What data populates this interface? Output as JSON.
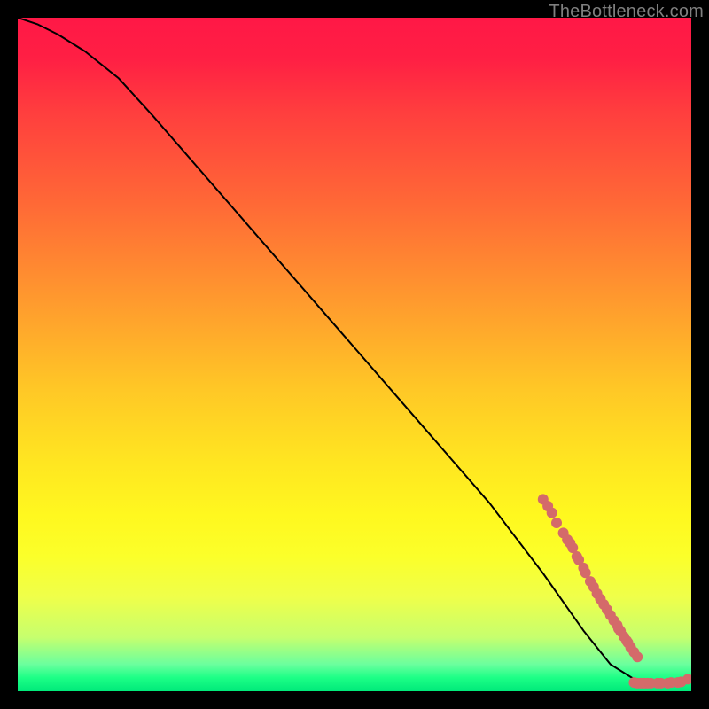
{
  "watermark": "TheBottleneck.com",
  "chart_data": {
    "type": "line",
    "title": "",
    "xlabel": "",
    "ylabel": "",
    "xlim": [
      0,
      100
    ],
    "ylim": [
      0,
      100
    ],
    "grid": false,
    "legend": false,
    "series": [
      {
        "name": "bottleneck-curve",
        "color": "#000000",
        "x": [
          0,
          3,
          6,
          10,
          15,
          20,
          30,
          40,
          50,
          60,
          70,
          78,
          84,
          88,
          92,
          96,
          100
        ],
        "y": [
          100,
          99,
          97.5,
          95,
          91,
          85.5,
          74,
          62.5,
          51,
          39.5,
          28,
          17.5,
          9,
          4,
          1.5,
          1,
          1.5
        ]
      }
    ],
    "markers": [
      {
        "name": "red-dots",
        "color": "#d46a6a",
        "radius": 6,
        "points": [
          {
            "x": 78,
            "y": 28.5
          },
          {
            "x": 78.7,
            "y": 27.5
          },
          {
            "x": 79.3,
            "y": 26.5
          },
          {
            "x": 80,
            "y": 25
          },
          {
            "x": 81,
            "y": 23.5
          },
          {
            "x": 81.6,
            "y": 22.5
          },
          {
            "x": 82,
            "y": 22
          },
          {
            "x": 82.4,
            "y": 21.3
          },
          {
            "x": 83,
            "y": 20
          },
          {
            "x": 83.3,
            "y": 19.5
          },
          {
            "x": 84,
            "y": 18.3
          },
          {
            "x": 84.3,
            "y": 17.6
          },
          {
            "x": 85,
            "y": 16.3
          },
          {
            "x": 85.5,
            "y": 15.5
          },
          {
            "x": 86,
            "y": 14.5
          },
          {
            "x": 86.5,
            "y": 13.7
          },
          {
            "x": 87,
            "y": 12.9
          },
          {
            "x": 87.5,
            "y": 12.1
          },
          {
            "x": 88,
            "y": 11.3
          },
          {
            "x": 88.5,
            "y": 10.5
          },
          {
            "x": 89,
            "y": 9.8
          },
          {
            "x": 89.2,
            "y": 9.3
          },
          {
            "x": 89.5,
            "y": 8.9
          },
          {
            "x": 90,
            "y": 8.1
          },
          {
            "x": 90.4,
            "y": 7.5
          },
          {
            "x": 90.6,
            "y": 7.2
          },
          {
            "x": 91,
            "y": 6.5
          },
          {
            "x": 91.5,
            "y": 5.8
          },
          {
            "x": 92,
            "y": 5.1
          },
          {
            "x": 91.5,
            "y": 1.3
          },
          {
            "x": 92,
            "y": 1.2
          },
          {
            "x": 92.5,
            "y": 1.2
          },
          {
            "x": 93,
            "y": 1.2
          },
          {
            "x": 93.5,
            "y": 1.2
          },
          {
            "x": 94,
            "y": 1.2
          },
          {
            "x": 95,
            "y": 1.2
          },
          {
            "x": 95.5,
            "y": 1.2
          },
          {
            "x": 96.5,
            "y": 1.2
          },
          {
            "x": 97,
            "y": 1.3
          },
          {
            "x": 98,
            "y": 1.3
          },
          {
            "x": 98.5,
            "y": 1.4
          },
          {
            "x": 99.5,
            "y": 1.8
          }
        ]
      }
    ]
  }
}
